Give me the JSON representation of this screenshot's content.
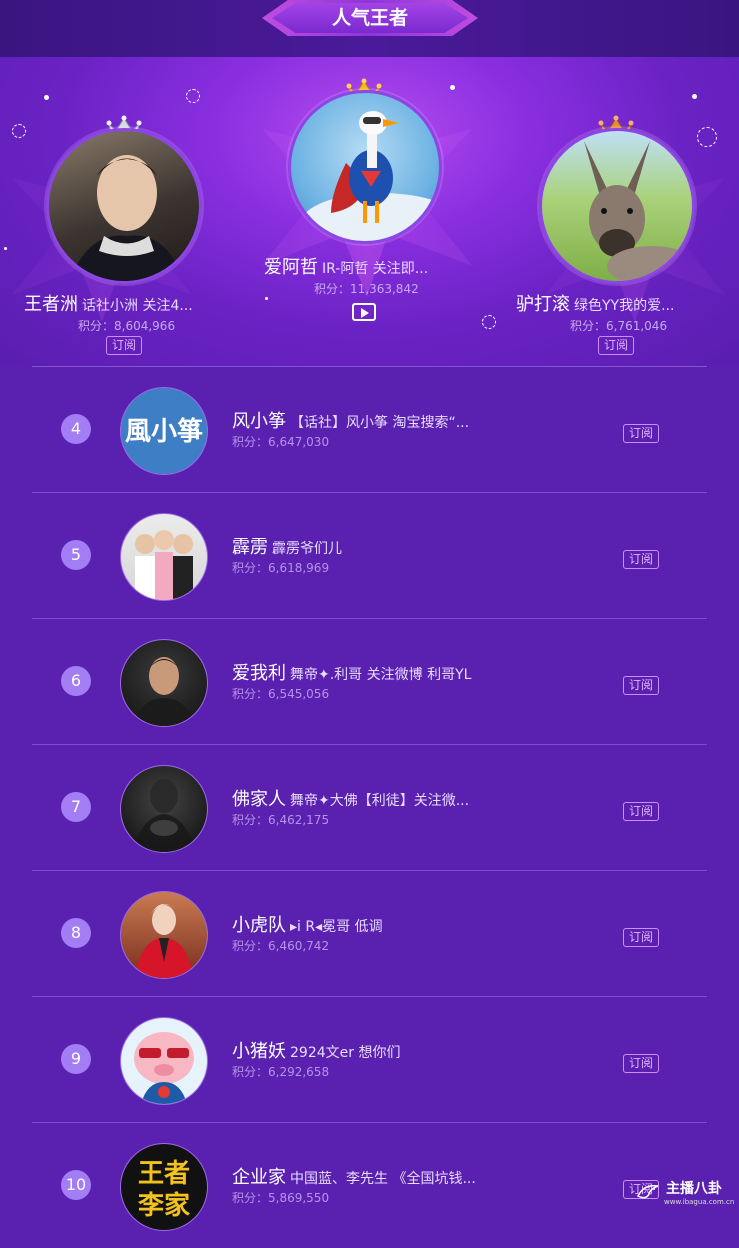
{
  "header": {
    "title": "人气王者"
  },
  "top3": [
    {
      "rank": "1",
      "name": "爱阿哲",
      "desc": "IR-阿哲 关注即...",
      "score": "积分：11,363,842",
      "has_live": true,
      "crown": "gold-crown-icon"
    },
    {
      "rank": "2",
      "name": "王者洲",
      "desc": "话社小洲 关注4...",
      "score": "积分：8,604,966",
      "subscribe": "订阅",
      "crown": "silver-crown-icon"
    },
    {
      "rank": "3",
      "name": "驴打滚",
      "desc": "绿色YY我的爱...",
      "score": "积分：6,761,046",
      "subscribe": "订阅",
      "crown": "bronze-crown-icon"
    }
  ],
  "list": [
    {
      "rank": "4",
      "name": "风小筝",
      "desc": "【话社】风小筝 淘宝搜索“...",
      "score": "积分：6,647,030",
      "subscribe": "订阅"
    },
    {
      "rank": "5",
      "name": "霹雳",
      "desc": "霹雳爷们儿",
      "score": "积分：6,618,969",
      "subscribe": "订阅"
    },
    {
      "rank": "6",
      "name": "爱我利",
      "desc": "舞帝✦.利哥 关注微博 利哥YL",
      "score": "积分：6,545,056",
      "subscribe": "订阅"
    },
    {
      "rank": "7",
      "name": "佛家人",
      "desc": "舞帝✦大佛【利徒】关注微...",
      "score": "积分：6,462,175",
      "subscribe": "订阅"
    },
    {
      "rank": "8",
      "name": "小虎队",
      "desc": "▸i R◂冕哥 低调",
      "score": "积分：6,460,742",
      "subscribe": "订阅"
    },
    {
      "rank": "9",
      "name": "小猪妖",
      "desc": "2924文er 想你们",
      "score": "积分：6,292,658",
      "subscribe": "订阅"
    },
    {
      "rank": "10",
      "name": "企业家",
      "desc": "中国蓝、李先生 《全国坑钱...",
      "score": "积分：5,869,550",
      "subscribe": "订阅"
    }
  ],
  "avatar_texts": {
    "r4": "風小箏",
    "r10_line1": "王者",
    "r10_line2": "李家"
  },
  "watermark": {
    "main": "主播八卦",
    "sub": "www.ibagua.com.cn"
  }
}
